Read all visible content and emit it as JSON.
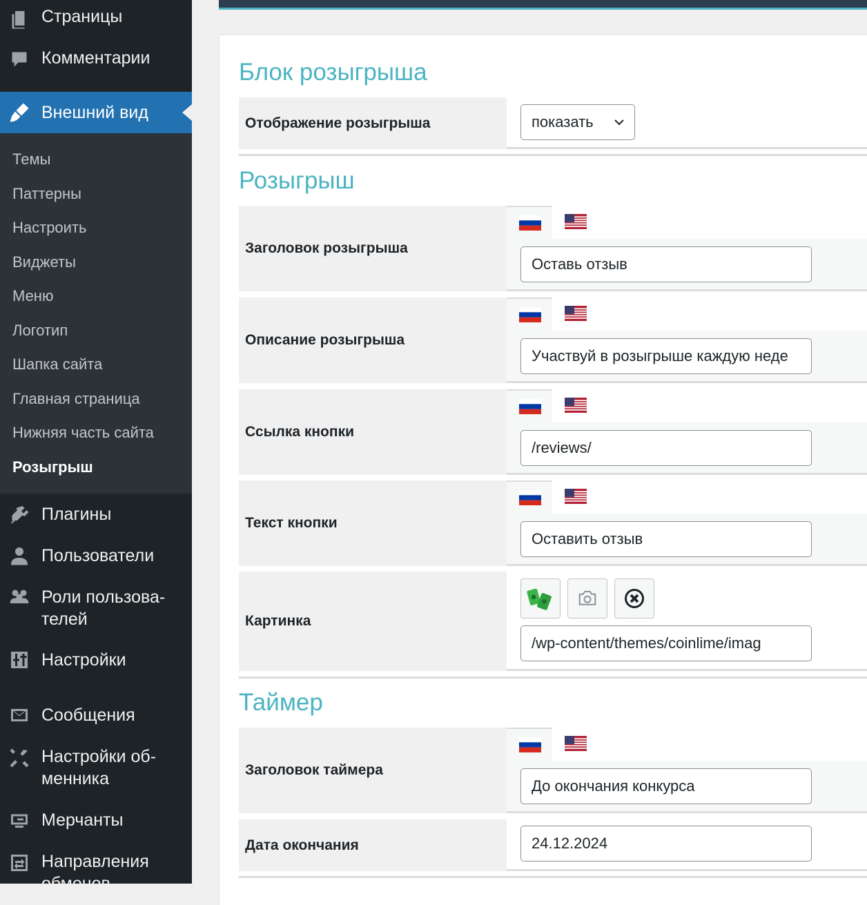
{
  "sidebar": {
    "top_items": [
      {
        "label": "Страницы",
        "icon": "pages-icon"
      },
      {
        "label": "Комментарии",
        "icon": "comments-icon"
      }
    ],
    "active_item": {
      "label": "Внешний вид",
      "icon": "appearance-brush-icon"
    },
    "submenu": [
      "Темы",
      "Паттерны",
      "Настроить",
      "Виджеты",
      "Меню",
      "Логотип",
      "Шапка сайта",
      "Главная страница",
      "Нижняя часть сайта",
      "Розыгрыш"
    ],
    "submenu_current": "Розыгрыш",
    "bottom_items": [
      {
        "label": "Плагины",
        "icon": "plugins-icon"
      },
      {
        "label": "Пользователи",
        "icon": "users-icon"
      },
      {
        "label_line1": "Роли пользова-",
        "label_line2": "телей",
        "icon": "user-roles-icon"
      },
      {
        "label": "Настройки",
        "icon": "settings-sliders-icon"
      },
      {
        "label": "Сообщения",
        "icon": "messages-envelope-icon"
      },
      {
        "label_line1": "Настройки об-",
        "label_line2": "менника",
        "icon": "exchange-tools-icon"
      },
      {
        "label": "Мерчанты",
        "icon": "merchants-icon"
      },
      {
        "label_line1": "Направления",
        "label_line2": "обменов",
        "icon": "exchange-directions-icon"
      }
    ]
  },
  "sections": {
    "block": {
      "title": "Блок розыгрыша",
      "display_label": "Отображение розыгрыша",
      "display_value": "показать"
    },
    "giveaway": {
      "title": "Розыгрыш",
      "title_label": "Заголовок розыгрыша",
      "title_value": "Оставь отзыв",
      "description_label": "Описание розыгрыша",
      "description_value": "Участвуй в розыгрыше каждую неде",
      "button_link_label": "Ссылка кнопки",
      "button_link_value": "/reviews/",
      "button_text_label": "Текст кнопки",
      "button_text_value": "Оставить отзыв",
      "image_label": "Картинка",
      "image_value": "/wp-content/themes/coinlime/imag"
    },
    "timer": {
      "title": "Таймер",
      "timer_title_label": "Заголовок таймера",
      "timer_title_value": "До окончания конкурса",
      "end_date_label": "Дата окончания",
      "end_date_value": "24.12.2024"
    }
  },
  "colors": {
    "sidebar_bg": "#1d2327",
    "submenu_bg": "#2c3338",
    "active_blue": "#2271b1",
    "section_title": "#4ab3c2"
  }
}
